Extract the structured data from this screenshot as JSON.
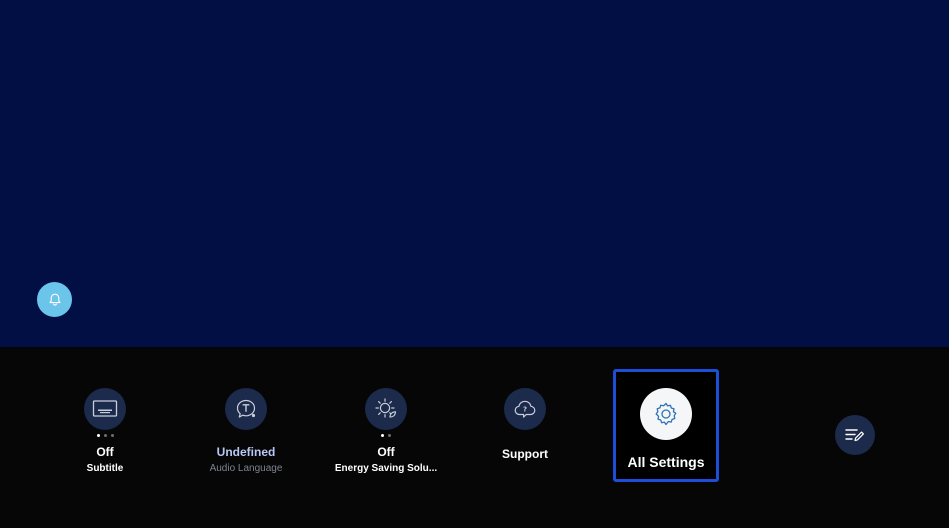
{
  "settings_bar": {
    "items": [
      {
        "icon": "subtitle-icon",
        "value": "Off",
        "label": "Subtitle",
        "dots": 3,
        "active_dot": 0
      },
      {
        "icon": "audio-language-icon",
        "value": "Undefined",
        "label": "Audio Language"
      },
      {
        "icon": "energy-saving-icon",
        "value": "Off",
        "label": "Energy Saving Solu...",
        "dots": 2,
        "active_dot": 0
      },
      {
        "icon": "support-icon",
        "value": "Support"
      }
    ],
    "focused": {
      "icon": "gear-icon",
      "label": "All Settings"
    },
    "edit_icon": "edit-list-icon"
  },
  "notification": {
    "icon": "bell-icon"
  },
  "colors": {
    "content_bg": "#010f45",
    "bar_bg": "#060606",
    "icon_circle": "#1c2a4b",
    "focus_border": "#1d4ed8",
    "notification": "#6bc4ea",
    "accent_text": "#b9c7f6"
  }
}
